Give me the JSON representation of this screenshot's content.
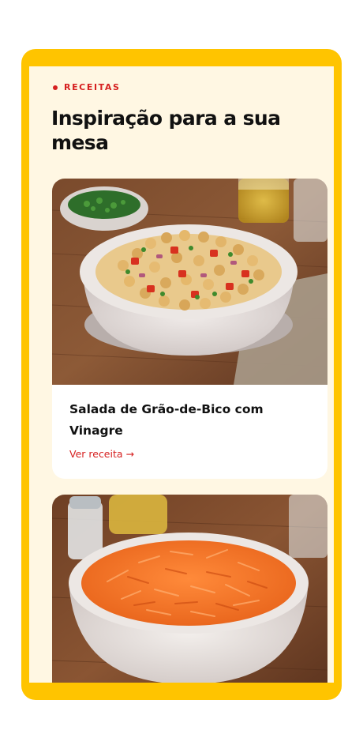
{
  "section": {
    "eyebrow": "RECEITAS",
    "title": "Inspiração para a sua mesa"
  },
  "recipes": [
    {
      "title": "Salada de Grão-de-Bico com Vinagre",
      "link_label": "Ver receita →",
      "image": "chickpea-salad-bowl"
    },
    {
      "title": "",
      "link_label": "",
      "image": "grated-carrot-bowl"
    }
  ],
  "colors": {
    "frame": "#ffc400",
    "panel": "#fff7e3",
    "accent": "#d62020",
    "text": "#111111"
  }
}
